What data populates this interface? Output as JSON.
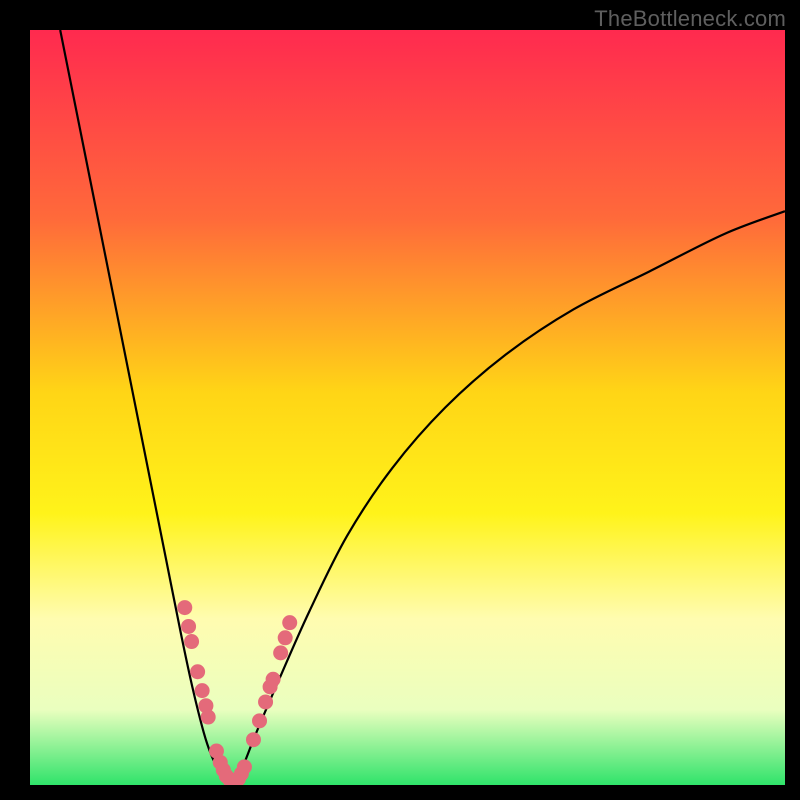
{
  "attribution": "TheBottleneck.com",
  "chart_data": {
    "type": "line",
    "title": "",
    "xlabel": "",
    "ylabel": "",
    "xlim": [
      0,
      100
    ],
    "ylim": [
      0,
      100
    ],
    "grid": false,
    "legend": false,
    "background_gradient": {
      "stops": [
        {
          "offset": 0,
          "color": "#ff2a4f"
        },
        {
          "offset": 25,
          "color": "#ff6a3a"
        },
        {
          "offset": 48,
          "color": "#ffd516"
        },
        {
          "offset": 64,
          "color": "#fff31a"
        },
        {
          "offset": 78,
          "color": "#fffcb0"
        },
        {
          "offset": 90,
          "color": "#eaffbf"
        },
        {
          "offset": 100,
          "color": "#2fe36a"
        }
      ]
    },
    "series": [
      {
        "name": "left-branch",
        "type": "line",
        "color": "#000000",
        "x": [
          4,
          6,
          8,
          10,
          12,
          14,
          16,
          18,
          20,
          21.5,
          23,
          24,
          25,
          26
        ],
        "y": [
          100,
          90,
          80,
          70,
          60,
          50,
          40,
          30,
          20,
          13,
          7,
          4,
          2,
          0.5
        ]
      },
      {
        "name": "right-branch",
        "type": "line",
        "color": "#000000",
        "x": [
          27,
          28,
          30,
          33,
          37,
          42,
          48,
          55,
          63,
          72,
          82,
          92,
          100
        ],
        "y": [
          0.5,
          2,
          7,
          14,
          23,
          33,
          42,
          50,
          57,
          63,
          68,
          73,
          76
        ]
      },
      {
        "name": "left-markers",
        "type": "scatter",
        "color": "#e46a7a",
        "x": [
          20.5,
          21.0,
          21.4,
          22.2,
          22.8,
          23.3,
          23.6,
          24.7,
          25.2,
          25.6,
          26.0,
          26.4
        ],
        "y": [
          23.5,
          21.0,
          19.0,
          15.0,
          12.5,
          10.5,
          9.0,
          4.5,
          3.0,
          2.0,
          1.2,
          0.8
        ]
      },
      {
        "name": "right-markers",
        "type": "scatter",
        "color": "#e46a7a",
        "x": [
          27.6,
          28.0,
          28.4,
          29.6,
          30.4,
          31.2,
          31.8,
          32.2,
          33.2,
          33.8,
          34.4
        ],
        "y": [
          0.8,
          1.5,
          2.4,
          6.0,
          8.5,
          11.0,
          13.0,
          14.0,
          17.5,
          19.5,
          21.5
        ]
      },
      {
        "name": "bottom-markers",
        "type": "scatter",
        "color": "#e46a7a",
        "x": [
          26.6,
          27.0,
          27.3
        ],
        "y": [
          0.5,
          0.5,
          0.5
        ]
      }
    ]
  }
}
